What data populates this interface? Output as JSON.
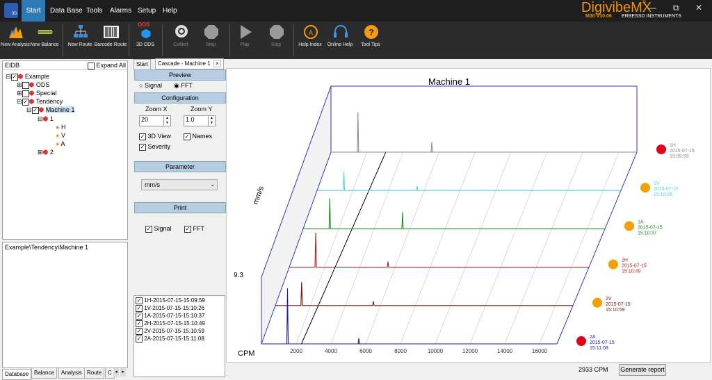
{
  "app": {
    "brand_name": "DigivibeMX",
    "brand_tm": "®",
    "version": "M30 V10.06",
    "company": "ERBESSD INSTRUMENTS",
    "window_controls": [
      "—",
      "⧉",
      "✕"
    ]
  },
  "menu": [
    "Start",
    "Data Base",
    "Tools",
    "Alarms",
    "Setup",
    "Help"
  ],
  "ribbon": [
    {
      "label": "New Analysis",
      "icon": "analysis-icon"
    },
    {
      "label": "New Balance",
      "icon": "balance-icon"
    },
    {
      "label": "New Route",
      "icon": "route-icon"
    },
    {
      "label": "Barcode Route",
      "icon": "barcode-icon"
    },
    {
      "label": "3D ODS",
      "icon": "ods-icon",
      "badge": "ODS"
    },
    {
      "label": "Collect",
      "icon": "collect-icon"
    },
    {
      "label": "Stop",
      "icon": "stop-icon"
    },
    {
      "label": "Play",
      "icon": "play-icon"
    },
    {
      "label": "Stop",
      "icon": "stop-icon"
    },
    {
      "label": "Help Index",
      "icon": "help-index-icon"
    },
    {
      "label": "Online Help",
      "icon": "headset-icon"
    },
    {
      "label": "Tool Tips",
      "icon": "question-icon"
    }
  ],
  "left": {
    "title": "EIDB",
    "expand_all": "Expand All",
    "tree": [
      "Example",
      "ODS",
      "Special",
      "Tendency",
      "Machine 1",
      "1",
      "H",
      "V",
      "A",
      "2"
    ],
    "path": "Example\\Tendency\\Machine 1",
    "tabs": [
      "Database",
      "Balance",
      "Analysis",
      "Route",
      "C"
    ]
  },
  "doc_tabs": {
    "start": "Start",
    "active": "Cascade - Machine 1",
    "close": "×"
  },
  "options": {
    "preview": {
      "title": "Preview",
      "signal": "Signal",
      "fft": "FFT"
    },
    "config": {
      "title": "Configuration",
      "zoom_x_label": "Zoom X",
      "zoom_y_label": "Zoom Y",
      "zoom_x": "20",
      "zoom_y": "1.0",
      "view3d": "3D View",
      "names": "Names",
      "severity": "Severity"
    },
    "parameter": {
      "title": "Parameter",
      "value": "mm/s"
    },
    "print": {
      "title": "Print",
      "signal": "Signal",
      "fft": "FFT"
    },
    "records": [
      "1H-2015-07-15-15:09:59",
      "1V-2015-07-15-15:10:26",
      "1A-2015-07-15-15:10:37",
      "2H-2015-07-15-15:10:49",
      "2V-2015-07-15-15:10:59",
      "2A-2015-07-15-15:11:08"
    ]
  },
  "footer": {
    "cpm_value": "2933",
    "cpm_unit": "CPM",
    "generate": "Generate report"
  },
  "chart_data": {
    "type": "line",
    "title": "Machine 1",
    "xlabel": "CPM",
    "ylabel": "mm/s",
    "y_marker": "9.3",
    "x_ticks": [
      "2000",
      "4000",
      "6000",
      "8000",
      "10000",
      "12000",
      "14000",
      "16000"
    ],
    "xlim": [
      0,
      17000
    ],
    "series": [
      {
        "name": "1H",
        "date": "2015-07-15",
        "time": "15:09:59",
        "color": "#8c8c8c",
        "severity": "#e0001a",
        "peaks": [
          [
            1500,
            0.72
          ],
          [
            5600,
            0.18
          ]
        ]
      },
      {
        "name": "1V",
        "date": "2015-07-15",
        "time": "15:10:26",
        "color": "#4fd3e0",
        "severity": "#f5a000",
        "peaks": [
          [
            1500,
            0.34
          ],
          [
            5600,
            0.08
          ]
        ]
      },
      {
        "name": "1A",
        "date": "2015-07-15",
        "time": "15:10:37",
        "color": "#1e8c1e",
        "severity": "#f5a000",
        "peaks": [
          [
            1500,
            0.55
          ],
          [
            5600,
            0.3
          ]
        ]
      },
      {
        "name": "2H",
        "date": "2015-07-15",
        "time": "15:10:49",
        "color": "#b01e1e",
        "severity": "#f5a000",
        "peaks": [
          [
            1500,
            0.62
          ],
          [
            5600,
            0.1
          ]
        ]
      },
      {
        "name": "2V",
        "date": "2015-07-15",
        "time": "15:10:59",
        "color": "#7a0f0f",
        "severity": "#f5a000",
        "peaks": [
          [
            1500,
            0.42
          ],
          [
            5600,
            0.08
          ]
        ]
      },
      {
        "name": "2A",
        "date": "2015-07-15",
        "time": "15:11:08",
        "color": "#1a1aa8",
        "severity": "#e0001a",
        "peaks": [
          [
            1500,
            1.0
          ],
          [
            5600,
            0.1
          ]
        ]
      }
    ]
  }
}
